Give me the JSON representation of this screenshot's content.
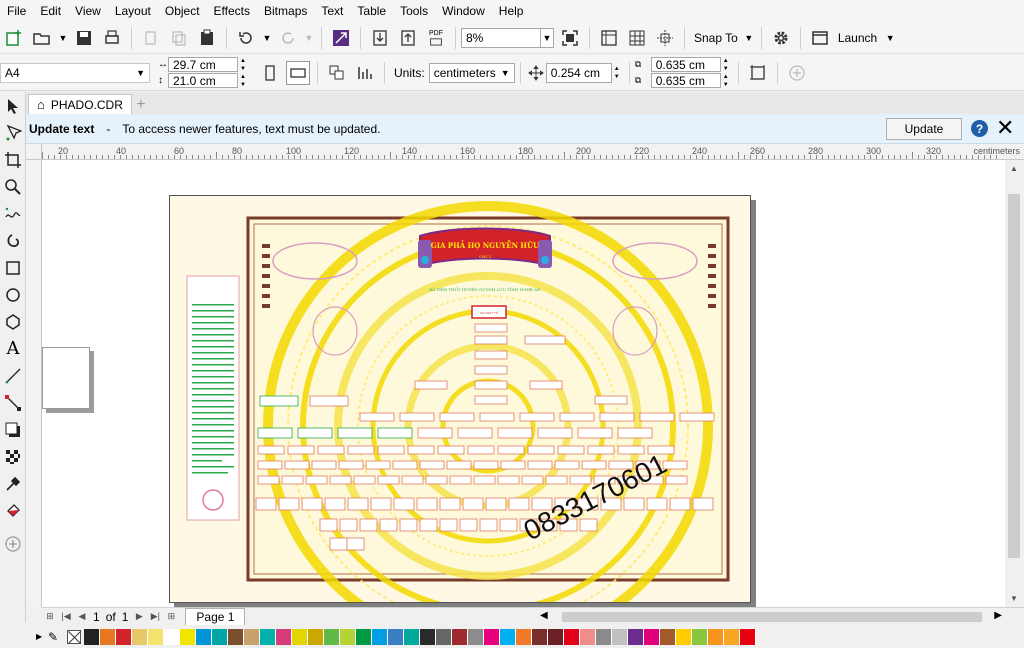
{
  "menu": [
    "File",
    "Edit",
    "View",
    "Layout",
    "Object",
    "Effects",
    "Bitmaps",
    "Text",
    "Table",
    "Tools",
    "Window",
    "Help"
  ],
  "toolbar": {
    "zoom": "8%",
    "snap_to": "Snap To",
    "launch": "Launch",
    "pdf_label": "PDF"
  },
  "property_bar": {
    "page_size": "A4",
    "width": "29.7 cm",
    "height": "21.0 cm",
    "units_label": "Units:",
    "units": "centimeters",
    "nudge": "0.254 cm",
    "dup_x": "0.635 cm",
    "dup_y": "0.635 cm"
  },
  "document_tab": "PHADO.CDR",
  "infobar": {
    "title": "Update text",
    "dash": "-",
    "message": "To access newer features, text must be updated.",
    "button": "Update"
  },
  "ruler": {
    "labels": [
      "20",
      "40",
      "60",
      "80",
      "100",
      "120",
      "140",
      "160",
      "180",
      "200",
      "220",
      "240",
      "260",
      "280",
      "300",
      "320"
    ],
    "unit": "centimeters"
  },
  "artwork": {
    "banner_title": "GIA PHẢ HỌ NGUYỄN HỮU",
    "banner_sub": "CHI 2",
    "subtitle": "XÃ TIÊN THỦY HUYỆN QUỲNH LƯU TỈNH NGHỆ AN",
    "root_box": "CỤ THỦY TỔ",
    "phone": "0833170601"
  },
  "page_nav": {
    "current": "1",
    "of": "of",
    "total": "1",
    "page_tab": "Page 1"
  },
  "palette_colors": [
    "#222222",
    "#e87722",
    "#d2232a",
    "#e8c96a",
    "#f5e36e",
    "#ffffff",
    "#f2e600",
    "#0094d9",
    "#00a6a6",
    "#7b4f2c",
    "#c9a26b",
    "#00b2a9",
    "#d73c7a",
    "#e3d500",
    "#c9a800",
    "#61b846",
    "#b5d334",
    "#009a44",
    "#009fe3",
    "#3a7fc1",
    "#00a99d",
    "#2a2a2a",
    "#666666",
    "#9e2a2f",
    "#8c8c8c",
    "#e6007e",
    "#00b0f0",
    "#f07a28",
    "#7a2e2a",
    "#6b1f27",
    "#e2001a",
    "#f08c8c",
    "#8a8a8a",
    "#c0c0c0",
    "#6a2c91",
    "#e2007a",
    "#a05a2c",
    "#ffcc00",
    "#8cc63f",
    "#f7941d",
    "#f6a623",
    "#e60012"
  ]
}
